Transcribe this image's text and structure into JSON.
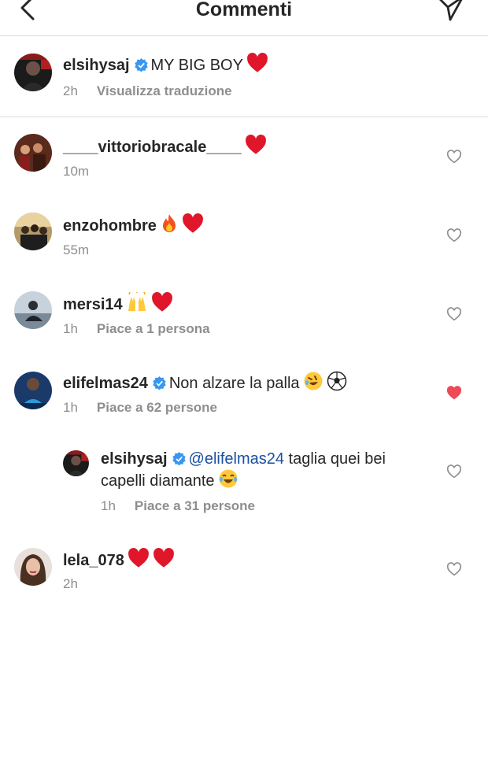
{
  "header": {
    "title": "Commenti",
    "back_icon": "chevron-left-icon",
    "send_icon": "paper-plane-icon"
  },
  "caption": {
    "username": "elsihysaj",
    "verified": true,
    "text": "MY BIG BOY",
    "time": "2h",
    "translate": "Visualizza traduzione"
  },
  "comments": [
    {
      "username": "____vittoriobracale____",
      "verified": false,
      "text": "",
      "time": "10m",
      "likes": "",
      "liked": false
    },
    {
      "username": "enzohombre",
      "verified": false,
      "text": "",
      "time": "55m",
      "likes": "",
      "liked": false
    },
    {
      "username": "mersi14",
      "verified": false,
      "text": "",
      "time": "1h",
      "likes": "Piace a 1 persona",
      "liked": false
    },
    {
      "username": "elifelmas24",
      "verified": true,
      "text": "Non alzare la palla",
      "time": "1h",
      "likes": "Piace a 62 persone",
      "liked": true
    },
    {
      "username": "lela_078",
      "verified": false,
      "text": "",
      "time": "2h",
      "likes": "",
      "liked": false
    }
  ],
  "reply": {
    "username": "elsihysaj",
    "verified": true,
    "mention": "@elifelmas24",
    "text_1": "taglia quei bei",
    "text_2": "capelli diamante",
    "time": "1h",
    "likes": "Piace a 31 persone"
  },
  "colors": {
    "liked_heart": "#ed4956",
    "verified": "#3897f0",
    "secondary_text": "#8e8e8e",
    "divider": "#dbdbdb"
  }
}
